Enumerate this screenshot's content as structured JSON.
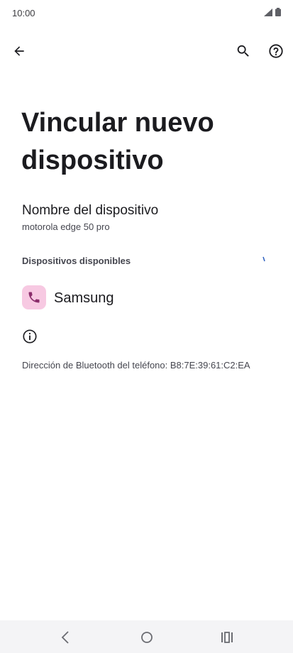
{
  "status": {
    "time": "10:00"
  },
  "appbar": {
    "back_icon": "arrow-back-icon",
    "search_icon": "search-icon",
    "help_icon": "help-icon"
  },
  "page": {
    "title": "Vincular nuevo dispositivo",
    "device_name_label": "Nombre del dispositivo",
    "device_name_value": "motorola edge 50 pro",
    "available_section": "Dispositivos disponibles",
    "bt_address": "Dirección de Bluetooth del teléfono: B8:7E:39:61:C2:EA"
  },
  "devices": [
    {
      "label": "Samsung",
      "icon": "phone-icon",
      "icon_bg": "#f7c9e2",
      "icon_color": "#8a2d6b"
    }
  ],
  "navbar": {
    "back": "nav-back-icon",
    "home": "nav-home-icon",
    "recents": "nav-recents-icon"
  }
}
